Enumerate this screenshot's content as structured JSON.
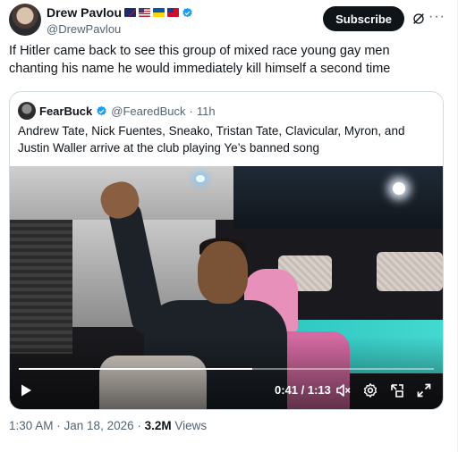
{
  "author": {
    "name": "Drew Pavlou",
    "handle": "@DrewPavlou",
    "flags": [
      "australia-flag",
      "usa-flag",
      "ukraine-flag",
      "taiwan-flag"
    ]
  },
  "actions": {
    "subscribe_label": "Subscribe",
    "grok_icon": "grok-icon",
    "more_icon": "more-icon",
    "more_glyph": "···"
  },
  "tweet": {
    "text": "If Hitler came back to see this group of mixed race young gay men chanting his name he would immediately kill himself a second time"
  },
  "quote": {
    "name": "FearBuck",
    "handle": "@FearedBuck",
    "separator": "·",
    "time": "11h",
    "text": "Andrew Tate, Nick Fuentes, Sneako, Tristan Tate, Clavicular, Myron, and Justin Waller arrive at the club playing Ye’s banned song",
    "video": {
      "current_time": "0:41",
      "time_separator": " / ",
      "duration": "1:13",
      "progress": 0.5616
    }
  },
  "footer": {
    "time": "1:30 AM",
    "separator": " · ",
    "date": "Jan 18, 2026",
    "separator2": " · ",
    "views_count": "3.2M",
    "views_label": "Views"
  },
  "colors": {
    "accent": "#1d9bf0",
    "text_primary": "#0f1419",
    "text_secondary": "#536471",
    "border": "#cfd9de"
  }
}
